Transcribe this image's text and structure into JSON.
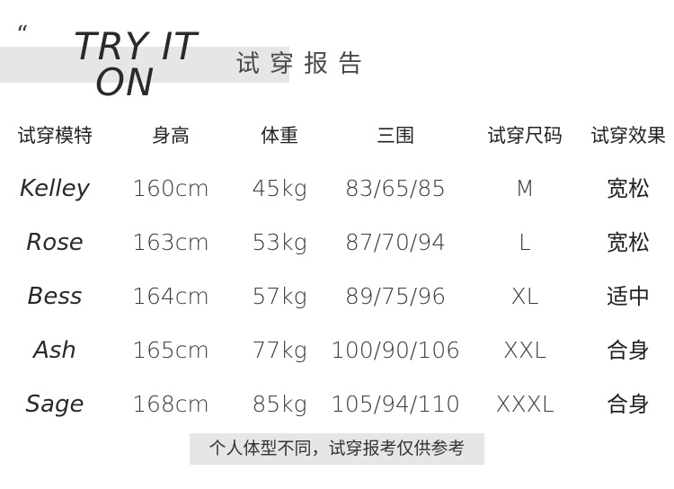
{
  "header": {
    "quote_mark": "“",
    "title_line1": "TRY IT",
    "title_line2": "ON",
    "subtitle": "试穿报告"
  },
  "table": {
    "columns": [
      "试穿模特",
      "身高",
      "体重",
      "三围",
      "试穿尺码",
      "试穿效果"
    ],
    "rows": [
      [
        "Kelley",
        "160cm",
        "45kg",
        "83/65/85",
        "M",
        "宽松"
      ],
      [
        "Rose",
        "163cm",
        "53kg",
        "87/70/94",
        "L",
        "宽松"
      ],
      [
        "Bess",
        "164cm",
        "57kg",
        "89/75/96",
        "XL",
        "适中"
      ],
      [
        "Ash",
        "165cm",
        "77kg",
        "100/90/106",
        "XXL",
        "合身"
      ],
      [
        "Sage",
        "168cm",
        "85kg",
        "105/94/110",
        "XXXL",
        "合身"
      ]
    ]
  },
  "footer": {
    "note": "个人体型不同，试穿报考仅供参考"
  }
}
